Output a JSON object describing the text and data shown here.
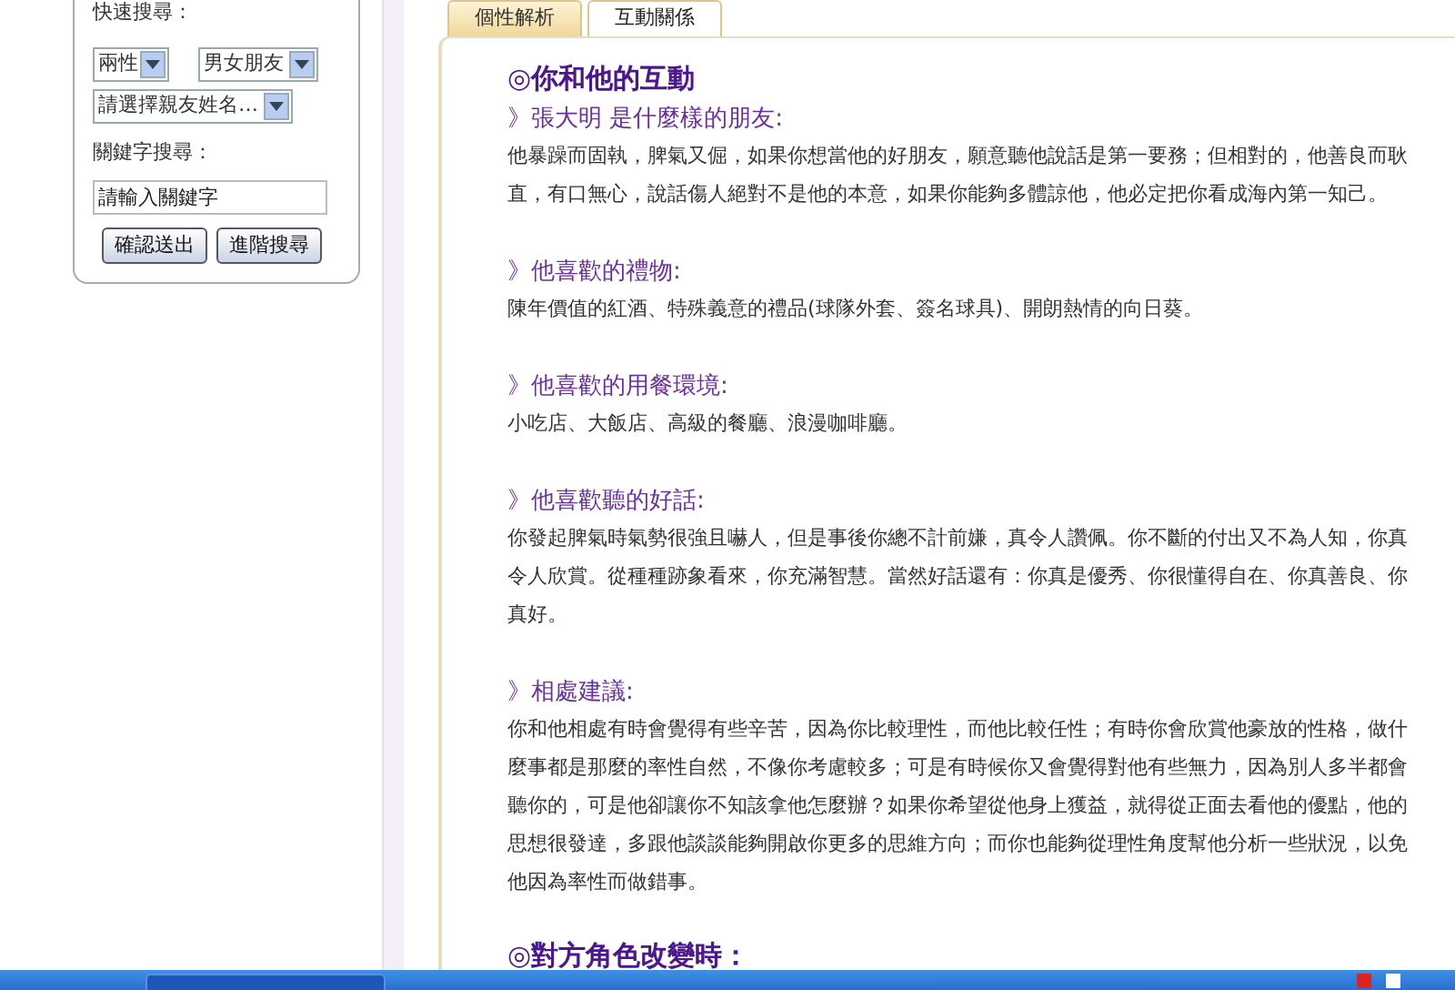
{
  "sidebar": {
    "quick_search_label": "快速搜尋：",
    "selects": [
      {
        "value": "兩性"
      },
      {
        "value": "男女朋友"
      },
      {
        "value": "請選擇親友姓名…"
      }
    ],
    "keyword_label": "關鍵字搜尋：",
    "keyword_field": {
      "placeholder": "請輸入關鍵字"
    },
    "buttons": [
      "確認送出",
      "進階搜尋"
    ]
  },
  "tabs": [
    {
      "label": "個性解析",
      "selected": false
    },
    {
      "label": "互動關係",
      "selected": true
    }
  ],
  "content": [
    {
      "kind": "title",
      "text": "◎你和他的互動"
    },
    {
      "kind": "subtitle",
      "text": "》張大明 是什麼樣的朋友:"
    },
    {
      "kind": "paragraph",
      "text": "他暴躁而固執，脾氣又倔，如果你想當他的好朋友，願意聽他說話是第一要務；但相對的，他善良而耿直，有口無心，說話傷人絕對不是他的本意，如果你能夠多體諒他，他必定把你看成海內第一知己。"
    },
    {
      "kind": "subtitle",
      "text": "》他喜歡的禮物:"
    },
    {
      "kind": "paragraph",
      "text": "陳年價值的紅酒、特殊義意的禮品(球隊外套、簽名球具)、開朗熱情的向日葵。"
    },
    {
      "kind": "subtitle",
      "text": "》他喜歡的用餐環境:"
    },
    {
      "kind": "paragraph",
      "text": "小吃店、大飯店、高級的餐廳、浪漫咖啡廳。"
    },
    {
      "kind": "subtitle",
      "text": "》他喜歡聽的好話:"
    },
    {
      "kind": "paragraph",
      "text": "你發起脾氣時氣勢很強且嚇人，但是事後你總不計前嫌，真令人讚佩。你不斷的付出又不為人知，你真令人欣賞。從種種跡象看來，你充滿智慧。當然好話還有：你真是優秀、你很懂得自在、你真善良、你真好。"
    },
    {
      "kind": "subtitle",
      "text": "》相處建議:"
    },
    {
      "kind": "paragraph",
      "text": "你和他相處有時會覺得有些辛苦，因為你比較理性，而他比較任性；有時你會欣賞他豪放的性格，做什麼事都是那麼的率性自然，不像你考慮較多；可是有時候你又會覺得對他有些無力，因為別人多半都會聽你的，可是他卻讓你不知該拿他怎麼辦？如果你希望從他身上獲益，就得從正面去看他的優點，他的思想很發達，多跟他談談能夠開啟你更多的思維方向；而你也能夠從理性角度幫他分析一些狀況，以免他因為率性而做錯事。"
    },
    {
      "kind": "title",
      "text": "◎對方角色改變時："
    }
  ]
}
